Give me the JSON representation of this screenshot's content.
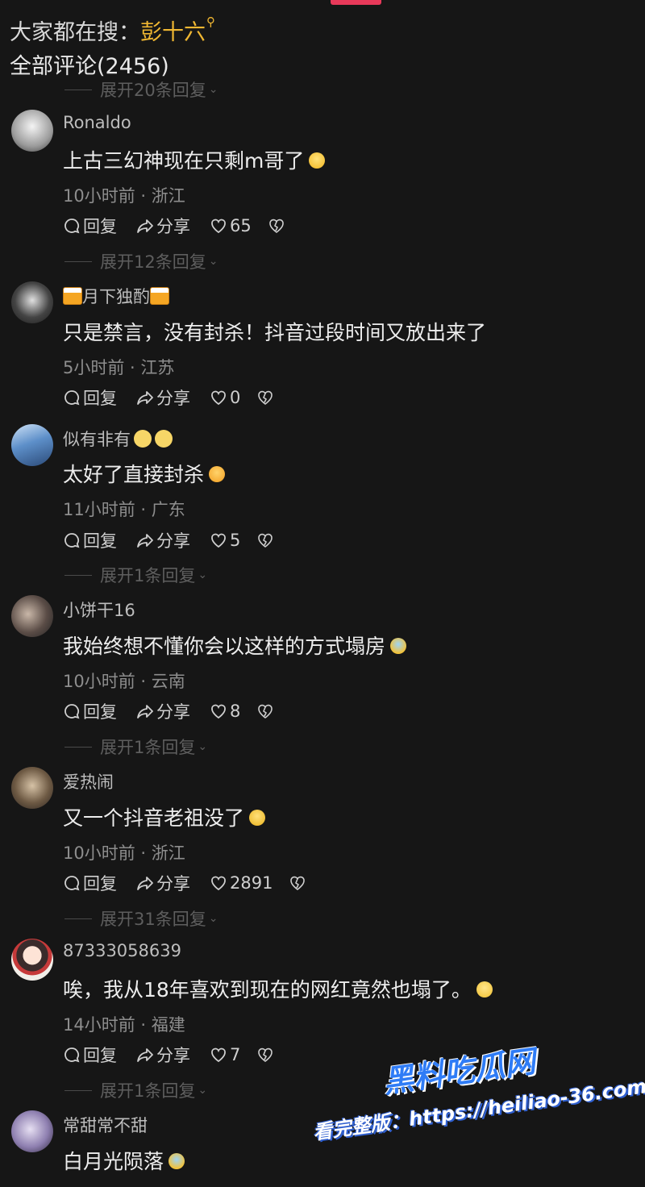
{
  "header": {
    "hot_search_prefix": "大家都在搜：",
    "hot_search_keyword": "彭十六",
    "all_comments_label": "全部评论(2456)"
  },
  "actions": {
    "reply_label": "回复",
    "share_label": "分享"
  },
  "expands": [
    "展开20条回复",
    "展开12条回复",
    "展开1条回复",
    "展开1条回复",
    "展开31条回复",
    "展开1条回复"
  ],
  "comments": [
    {
      "user": "Ronaldo",
      "text": "上古三幻神现在只剩m哥了",
      "time_location": "10小时前 · 浙江",
      "likes": "65"
    },
    {
      "user": "月下独酌",
      "text": "只是禁言，没有封杀！抖音过段时间又放出来了",
      "time_location": "5小时前 · 江苏",
      "likes": "0"
    },
    {
      "user": "似有非有",
      "text": "太好了直接封杀",
      "time_location": "11小时前 · 广东",
      "likes": "5"
    },
    {
      "user": "小饼干16",
      "text": "我始终想不懂你会以这样的方式塌房",
      "time_location": "10小时前 · 云南",
      "likes": "8"
    },
    {
      "user": "爱热闹",
      "text": "又一个抖音老祖没了",
      "time_location": "10小时前 · 浙江",
      "likes": "2891"
    },
    {
      "user": "87333058639",
      "text": "唉，我从18年喜欢到现在的网红竟然也塌了。",
      "time_location": "14小时前 · 福建",
      "likes": "7"
    },
    {
      "user": "常甜常不甜",
      "text": "白月光陨落"
    }
  ],
  "watermark": {
    "brand": "黑料吃瓜网",
    "url_line": "看完整版：https://heiliao-36.com"
  }
}
